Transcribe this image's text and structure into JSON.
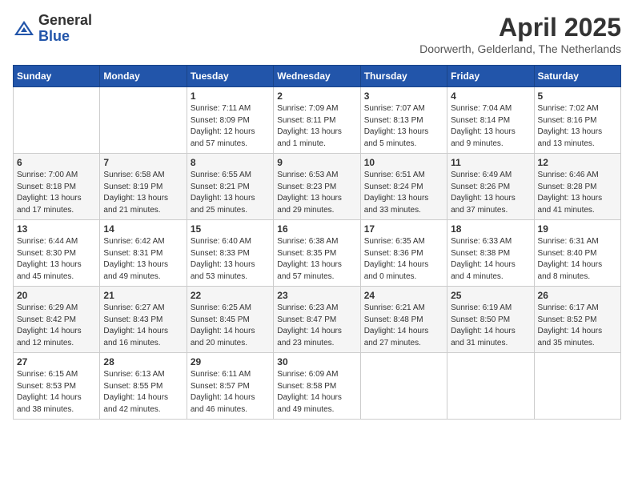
{
  "header": {
    "logo_general": "General",
    "logo_blue": "Blue",
    "month_year": "April 2025",
    "location": "Doorwerth, Gelderland, The Netherlands"
  },
  "weekdays": [
    "Sunday",
    "Monday",
    "Tuesday",
    "Wednesday",
    "Thursday",
    "Friday",
    "Saturday"
  ],
  "weeks": [
    [
      {
        "day": "",
        "sunrise": "",
        "sunset": "",
        "daylight": ""
      },
      {
        "day": "",
        "sunrise": "",
        "sunset": "",
        "daylight": ""
      },
      {
        "day": "1",
        "sunrise": "Sunrise: 7:11 AM",
        "sunset": "Sunset: 8:09 PM",
        "daylight": "Daylight: 12 hours and 57 minutes."
      },
      {
        "day": "2",
        "sunrise": "Sunrise: 7:09 AM",
        "sunset": "Sunset: 8:11 PM",
        "daylight": "Daylight: 13 hours and 1 minute."
      },
      {
        "day": "3",
        "sunrise": "Sunrise: 7:07 AM",
        "sunset": "Sunset: 8:13 PM",
        "daylight": "Daylight: 13 hours and 5 minutes."
      },
      {
        "day": "4",
        "sunrise": "Sunrise: 7:04 AM",
        "sunset": "Sunset: 8:14 PM",
        "daylight": "Daylight: 13 hours and 9 minutes."
      },
      {
        "day": "5",
        "sunrise": "Sunrise: 7:02 AM",
        "sunset": "Sunset: 8:16 PM",
        "daylight": "Daylight: 13 hours and 13 minutes."
      }
    ],
    [
      {
        "day": "6",
        "sunrise": "Sunrise: 7:00 AM",
        "sunset": "Sunset: 8:18 PM",
        "daylight": "Daylight: 13 hours and 17 minutes."
      },
      {
        "day": "7",
        "sunrise": "Sunrise: 6:58 AM",
        "sunset": "Sunset: 8:19 PM",
        "daylight": "Daylight: 13 hours and 21 minutes."
      },
      {
        "day": "8",
        "sunrise": "Sunrise: 6:55 AM",
        "sunset": "Sunset: 8:21 PM",
        "daylight": "Daylight: 13 hours and 25 minutes."
      },
      {
        "day": "9",
        "sunrise": "Sunrise: 6:53 AM",
        "sunset": "Sunset: 8:23 PM",
        "daylight": "Daylight: 13 hours and 29 minutes."
      },
      {
        "day": "10",
        "sunrise": "Sunrise: 6:51 AM",
        "sunset": "Sunset: 8:24 PM",
        "daylight": "Daylight: 13 hours and 33 minutes."
      },
      {
        "day": "11",
        "sunrise": "Sunrise: 6:49 AM",
        "sunset": "Sunset: 8:26 PM",
        "daylight": "Daylight: 13 hours and 37 minutes."
      },
      {
        "day": "12",
        "sunrise": "Sunrise: 6:46 AM",
        "sunset": "Sunset: 8:28 PM",
        "daylight": "Daylight: 13 hours and 41 minutes."
      }
    ],
    [
      {
        "day": "13",
        "sunrise": "Sunrise: 6:44 AM",
        "sunset": "Sunset: 8:30 PM",
        "daylight": "Daylight: 13 hours and 45 minutes."
      },
      {
        "day": "14",
        "sunrise": "Sunrise: 6:42 AM",
        "sunset": "Sunset: 8:31 PM",
        "daylight": "Daylight: 13 hours and 49 minutes."
      },
      {
        "day": "15",
        "sunrise": "Sunrise: 6:40 AM",
        "sunset": "Sunset: 8:33 PM",
        "daylight": "Daylight: 13 hours and 53 minutes."
      },
      {
        "day": "16",
        "sunrise": "Sunrise: 6:38 AM",
        "sunset": "Sunset: 8:35 PM",
        "daylight": "Daylight: 13 hours and 57 minutes."
      },
      {
        "day": "17",
        "sunrise": "Sunrise: 6:35 AM",
        "sunset": "Sunset: 8:36 PM",
        "daylight": "Daylight: 14 hours and 0 minutes."
      },
      {
        "day": "18",
        "sunrise": "Sunrise: 6:33 AM",
        "sunset": "Sunset: 8:38 PM",
        "daylight": "Daylight: 14 hours and 4 minutes."
      },
      {
        "day": "19",
        "sunrise": "Sunrise: 6:31 AM",
        "sunset": "Sunset: 8:40 PM",
        "daylight": "Daylight: 14 hours and 8 minutes."
      }
    ],
    [
      {
        "day": "20",
        "sunrise": "Sunrise: 6:29 AM",
        "sunset": "Sunset: 8:42 PM",
        "daylight": "Daylight: 14 hours and 12 minutes."
      },
      {
        "day": "21",
        "sunrise": "Sunrise: 6:27 AM",
        "sunset": "Sunset: 8:43 PM",
        "daylight": "Daylight: 14 hours and 16 minutes."
      },
      {
        "day": "22",
        "sunrise": "Sunrise: 6:25 AM",
        "sunset": "Sunset: 8:45 PM",
        "daylight": "Daylight: 14 hours and 20 minutes."
      },
      {
        "day": "23",
        "sunrise": "Sunrise: 6:23 AM",
        "sunset": "Sunset: 8:47 PM",
        "daylight": "Daylight: 14 hours and 23 minutes."
      },
      {
        "day": "24",
        "sunrise": "Sunrise: 6:21 AM",
        "sunset": "Sunset: 8:48 PM",
        "daylight": "Daylight: 14 hours and 27 minutes."
      },
      {
        "day": "25",
        "sunrise": "Sunrise: 6:19 AM",
        "sunset": "Sunset: 8:50 PM",
        "daylight": "Daylight: 14 hours and 31 minutes."
      },
      {
        "day": "26",
        "sunrise": "Sunrise: 6:17 AM",
        "sunset": "Sunset: 8:52 PM",
        "daylight": "Daylight: 14 hours and 35 minutes."
      }
    ],
    [
      {
        "day": "27",
        "sunrise": "Sunrise: 6:15 AM",
        "sunset": "Sunset: 8:53 PM",
        "daylight": "Daylight: 14 hours and 38 minutes."
      },
      {
        "day": "28",
        "sunrise": "Sunrise: 6:13 AM",
        "sunset": "Sunset: 8:55 PM",
        "daylight": "Daylight: 14 hours and 42 minutes."
      },
      {
        "day": "29",
        "sunrise": "Sunrise: 6:11 AM",
        "sunset": "Sunset: 8:57 PM",
        "daylight": "Daylight: 14 hours and 46 minutes."
      },
      {
        "day": "30",
        "sunrise": "Sunrise: 6:09 AM",
        "sunset": "Sunset: 8:58 PM",
        "daylight": "Daylight: 14 hours and 49 minutes."
      },
      {
        "day": "",
        "sunrise": "",
        "sunset": "",
        "daylight": ""
      },
      {
        "day": "",
        "sunrise": "",
        "sunset": "",
        "daylight": ""
      },
      {
        "day": "",
        "sunrise": "",
        "sunset": "",
        "daylight": ""
      }
    ]
  ]
}
